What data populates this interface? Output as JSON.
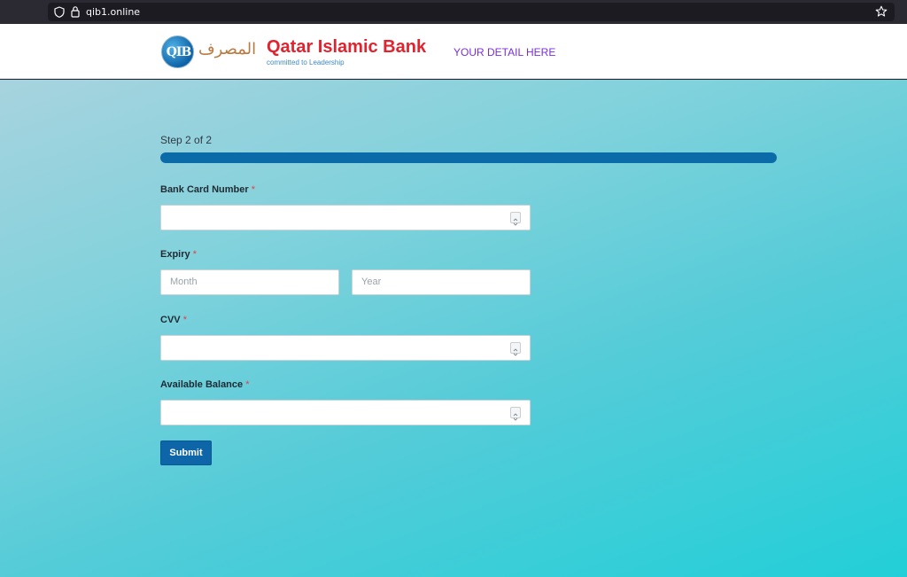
{
  "browser": {
    "url": "qib1.online"
  },
  "header": {
    "logo_monogram": "QIB",
    "logo_arabic": "المصرف",
    "brand_name": "Qatar Islamic Bank",
    "tagline": "committed to Leadership",
    "link_label": "YOUR DETAIL HERE"
  },
  "form": {
    "step_text": "Step 2 of 2",
    "progress_fraction": 1.0,
    "required_marker": "*",
    "card_number": {
      "label": "Bank Card Number",
      "value": ""
    },
    "expiry": {
      "label": "Expiry",
      "month_placeholder": "Month",
      "year_placeholder": "Year"
    },
    "cvv": {
      "label": "CVV",
      "value": ""
    },
    "balance": {
      "label": "Available Balance",
      "value": ""
    },
    "submit_label": "Submit"
  },
  "colors": {
    "brand_red": "#e0232e",
    "accent_blue": "#0b6aa8",
    "link_purple": "#7a2de0",
    "background_teal": "#22cfd8"
  }
}
